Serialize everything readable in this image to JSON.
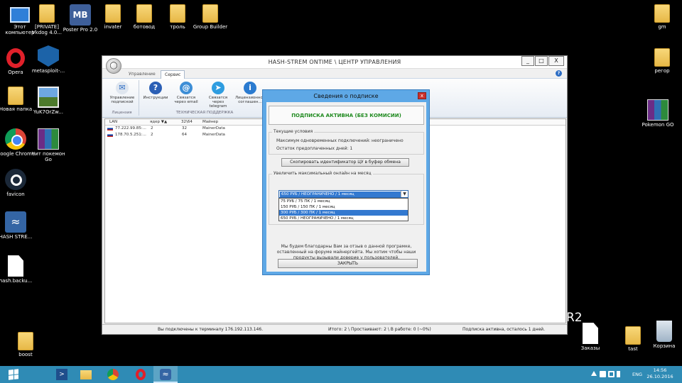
{
  "desktop": {
    "icons_left": [
      {
        "label": "Этот компьютер",
        "icon": "computer-icon"
      },
      {
        "label": "[PRIVATE] Vkdog 4.0...",
        "icon": "folder-icon"
      },
      {
        "label": "Poster Pro 2.0",
        "icon": "mb-app-icon"
      },
      {
        "label": "invater",
        "icon": "folder-icon"
      },
      {
        "label": "ботовод",
        "icon": "folder-icon"
      },
      {
        "label": "троль",
        "icon": "folder-icon"
      },
      {
        "label": "Group Builder",
        "icon": "folder-icon"
      },
      {
        "label": "Opera",
        "icon": "opera-icon"
      },
      {
        "label": "metasploit-...",
        "icon": "metasploit-icon"
      },
      {
        "label": "Новая папка",
        "icon": "folder-icon"
      },
      {
        "label": "YuK7OrZw...",
        "icon": "image-file-icon"
      },
      {
        "label": "Google Chrome",
        "icon": "chrome-icon"
      },
      {
        "label": "Чит покемон Go",
        "icon": "winrar-icon"
      },
      {
        "label": "favicon",
        "icon": "steam-icon"
      },
      {
        "label": "HASH STRE...",
        "icon": "hash-app-icon"
      },
      {
        "label": "hash.backu...",
        "icon": "file-icon"
      },
      {
        "label": "boost",
        "icon": "folder-icon"
      }
    ],
    "icons_right": [
      {
        "label": "gm",
        "icon": "folder-icon"
      },
      {
        "label": "регор",
        "icon": "folder-icon"
      },
      {
        "label": "Pokemon GO",
        "icon": "winrar-icon"
      },
      {
        "label": "Заказы",
        "icon": "file-icon"
      },
      {
        "label": "tast",
        "icon": "folder-icon"
      },
      {
        "label": "Корзина",
        "icon": "recycle-bin-icon"
      }
    ],
    "watermark": "R2"
  },
  "window": {
    "title": "HASH-STREM ONTIME \\ ЦЕНТР УПРАВЛЕНИЯ",
    "controls": {
      "minimize": "_",
      "maximize": "□",
      "close": "X"
    },
    "tabs": [
      {
        "label": "Управление",
        "active": false
      },
      {
        "label": "Сервис",
        "active": true
      }
    ],
    "help": "?",
    "ribbon": {
      "groups": [
        {
          "label": "Лицензия",
          "buttons": [
            {
              "label": "Управление подпиской",
              "icon": "subscription-icon"
            }
          ]
        },
        {
          "label": "ТЕХНИЧЕСКАЯ ПОДДЕРЖКА",
          "buttons": [
            {
              "label": "Инструкции",
              "icon": "question-icon"
            },
            {
              "label": "Связатся через email",
              "icon": "email-icon"
            },
            {
              "label": "Связатся через telegram",
              "icon": "telegram-icon"
            },
            {
              "label": "Лицензионное соглашен...",
              "icon": "info-icon"
            }
          ]
        }
      ]
    },
    "grid": {
      "columns": [
        "LAN",
        "ядер ▼▲",
        "32\\64",
        "Майнер"
      ],
      "rows": [
        {
          "lan": "77.222.99.85:...",
          "cores": "2",
          "bits": "32",
          "miner": "MainerData"
        },
        {
          "lan": "178.70.5.251:...",
          "cores": "2",
          "bits": "64",
          "miner": "MainerData"
        }
      ]
    },
    "status": {
      "connected": "Вы подключены к терминалу 176.192.113.146.",
      "totals": "Итого: 2 \\ Простаивают: 2 \\ В работе: 0 (~0%)",
      "subscription": "Подписка активна, осталось 1 дней."
    }
  },
  "dialog": {
    "title": "Сведения о подписке",
    "close": "x",
    "banner": "ПОДПИСКА АКТИВНА (БЕЗ КОМИСИИ)",
    "current": {
      "legend": "Текущие условия",
      "max_connections": "Максимум одновременных подключений: неограничено",
      "days_left": "Остаток предоплаченных дней: 1"
    },
    "copy_button": "Скопировать идентификатор ЦУ в буфер обмена",
    "upgrade": {
      "legend": "Увеличить максимальный онлайн на месяц",
      "selected": "650 РУБ / НЕОГРАНИЧЕНО / 1 месяц",
      "options": [
        {
          "label": "75 РУБ / 75 ПК / 1 месяц",
          "highlighted": false
        },
        {
          "label": "150 РУБ / 150 ПК / 1 месяц",
          "highlighted": false
        },
        {
          "label": "300 РУБ / 300 ПК / 1 месяц",
          "highlighted": true
        },
        {
          "label": "650 РУБ / НЕОГРАНИЧЕНО / 1 месяц",
          "highlighted": false
        }
      ]
    },
    "message": "Мы будем благодарны Вам за отзыв о данной програмке, оставленный на форуме майнергейта. Мы хотим чтобы наши продукты вызывали доверие у пользователей.",
    "close_button": "ЗАКРЫТЬ"
  },
  "taskbar": {
    "apps": [
      {
        "name": "powershell",
        "icon": "powershell-icon"
      },
      {
        "name": "explorer",
        "icon": "file-explorer-icon"
      },
      {
        "name": "chrome",
        "icon": "chrome-icon"
      },
      {
        "name": "opera",
        "icon": "opera-icon"
      },
      {
        "name": "hash-strem",
        "icon": "hash-app-icon",
        "active": true
      }
    ],
    "lang": "ENG",
    "time": "14:56",
    "date": "26.10.2016"
  }
}
